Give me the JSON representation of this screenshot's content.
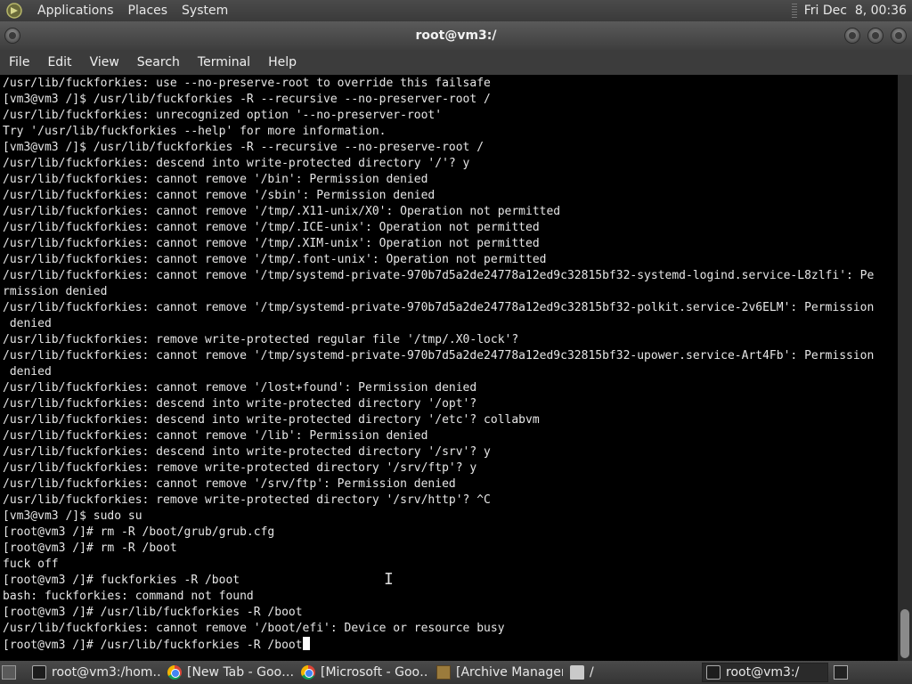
{
  "top_panel": {
    "menus": [
      "Applications",
      "Places",
      "System"
    ],
    "clock": "Fri Dec  8, 00:36"
  },
  "window": {
    "title": "root@vm3:/"
  },
  "menubar": [
    "File",
    "Edit",
    "View",
    "Search",
    "Terminal",
    "Help"
  ],
  "terminal": {
    "lines": [
      "/usr/lib/fuckforkies: use --no-preserve-root to override this failsafe",
      "[vm3@vm3 /]$ /usr/lib/fuckforkies -R --recursive --no-preserver-root /",
      "/usr/lib/fuckforkies: unrecognized option '--no-preserver-root'",
      "Try '/usr/lib/fuckforkies --help' for more information.",
      "[vm3@vm3 /]$ /usr/lib/fuckforkies -R --recursive --no-preserve-root /",
      "/usr/lib/fuckforkies: descend into write-protected directory '/'? y",
      "/usr/lib/fuckforkies: cannot remove '/bin': Permission denied",
      "/usr/lib/fuckforkies: cannot remove '/sbin': Permission denied",
      "/usr/lib/fuckforkies: cannot remove '/tmp/.X11-unix/X0': Operation not permitted",
      "/usr/lib/fuckforkies: cannot remove '/tmp/.ICE-unix': Operation not permitted",
      "/usr/lib/fuckforkies: cannot remove '/tmp/.XIM-unix': Operation not permitted",
      "/usr/lib/fuckforkies: cannot remove '/tmp/.font-unix': Operation not permitted",
      "/usr/lib/fuckforkies: cannot remove '/tmp/systemd-private-970b7d5a2de24778a12ed9c32815bf32-systemd-logind.service-L8zlfi': Pe",
      "rmission denied",
      "/usr/lib/fuckforkies: cannot remove '/tmp/systemd-private-970b7d5a2de24778a12ed9c32815bf32-polkit.service-2v6ELM': Permission",
      " denied",
      "/usr/lib/fuckforkies: remove write-protected regular file '/tmp/.X0-lock'?",
      "/usr/lib/fuckforkies: cannot remove '/tmp/systemd-private-970b7d5a2de24778a12ed9c32815bf32-upower.service-Art4Fb': Permission",
      " denied",
      "/usr/lib/fuckforkies: cannot remove '/lost+found': Permission denied",
      "/usr/lib/fuckforkies: descend into write-protected directory '/opt'?",
      "/usr/lib/fuckforkies: descend into write-protected directory '/etc'? collabvm",
      "/usr/lib/fuckforkies: cannot remove '/lib': Permission denied",
      "/usr/lib/fuckforkies: descend into write-protected directory '/srv'? y",
      "/usr/lib/fuckforkies: remove write-protected directory '/srv/ftp'? y",
      "/usr/lib/fuckforkies: cannot remove '/srv/ftp': Permission denied",
      "/usr/lib/fuckforkies: remove write-protected directory '/srv/http'? ^C",
      "[vm3@vm3 /]$ sudo su",
      "[root@vm3 /]# rm -R /boot/grub/grub.cfg",
      "[root@vm3 /]# rm -R /boot",
      "fuck off",
      "[root@vm3 /]# fuckforkies -R /boot",
      "bash: fuckforkies: command not found",
      "[root@vm3 /]# /usr/lib/fuckforkies -R /boot",
      "/usr/lib/fuckforkies: cannot remove '/boot/efi': Device or resource busy"
    ],
    "prompt_line": "[root@vm3 /]# /usr/lib/fuckforkies -R /boot"
  },
  "mouse_glyph": "I",
  "taskbar": {
    "tasks": [
      {
        "label": "root@vm3:/hom…",
        "icon": "terminal-icon"
      },
      {
        "label": "[New Tab - Goo…",
        "icon": "chrome-icon"
      },
      {
        "label": "[Microsoft - Goo…",
        "icon": "chrome-icon"
      },
      {
        "label": "[Archive Manager]",
        "icon": "archive-icon"
      },
      {
        "label": "/",
        "icon": "folder-icon"
      },
      {
        "label": "root@vm3:/",
        "icon": "terminal-icon"
      }
    ]
  }
}
